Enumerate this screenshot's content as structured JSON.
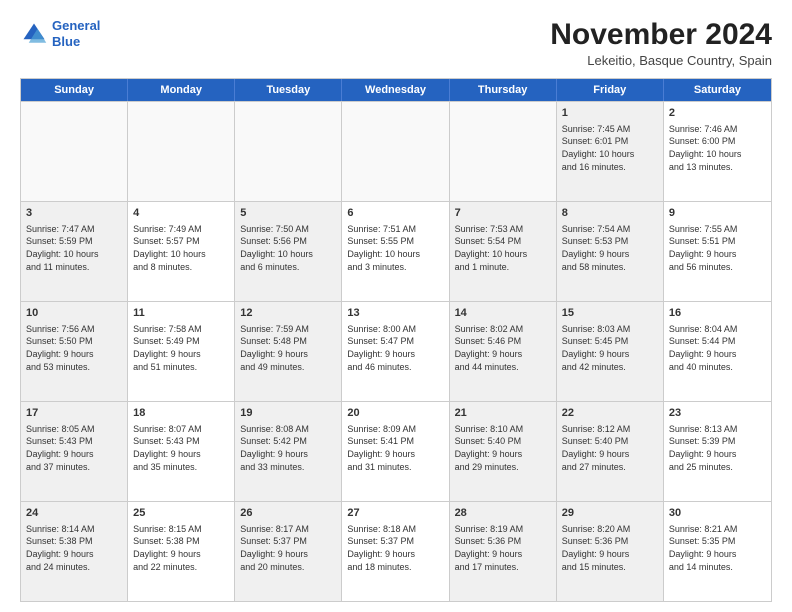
{
  "logo": {
    "line1": "General",
    "line2": "Blue"
  },
  "title": "November 2024",
  "location": "Lekeitio, Basque Country, Spain",
  "dayHeaders": [
    "Sunday",
    "Monday",
    "Tuesday",
    "Wednesday",
    "Thursday",
    "Friday",
    "Saturday"
  ],
  "rows": [
    [
      {
        "day": "",
        "info": "",
        "empty": true
      },
      {
        "day": "",
        "info": "",
        "empty": true
      },
      {
        "day": "",
        "info": "",
        "empty": true
      },
      {
        "day": "",
        "info": "",
        "empty": true
      },
      {
        "day": "",
        "info": "",
        "empty": true
      },
      {
        "day": "1",
        "info": "Sunrise: 7:45 AM\nSunset: 6:01 PM\nDaylight: 10 hours\nand 16 minutes.",
        "shaded": true
      },
      {
        "day": "2",
        "info": "Sunrise: 7:46 AM\nSunset: 6:00 PM\nDaylight: 10 hours\nand 13 minutes."
      }
    ],
    [
      {
        "day": "3",
        "info": "Sunrise: 7:47 AM\nSunset: 5:59 PM\nDaylight: 10 hours\nand 11 minutes.",
        "shaded": true
      },
      {
        "day": "4",
        "info": "Sunrise: 7:49 AM\nSunset: 5:57 PM\nDaylight: 10 hours\nand 8 minutes."
      },
      {
        "day": "5",
        "info": "Sunrise: 7:50 AM\nSunset: 5:56 PM\nDaylight: 10 hours\nand 6 minutes.",
        "shaded": true
      },
      {
        "day": "6",
        "info": "Sunrise: 7:51 AM\nSunset: 5:55 PM\nDaylight: 10 hours\nand 3 minutes."
      },
      {
        "day": "7",
        "info": "Sunrise: 7:53 AM\nSunset: 5:54 PM\nDaylight: 10 hours\nand 1 minute.",
        "shaded": true
      },
      {
        "day": "8",
        "info": "Sunrise: 7:54 AM\nSunset: 5:53 PM\nDaylight: 9 hours\nand 58 minutes.",
        "shaded": true
      },
      {
        "day": "9",
        "info": "Sunrise: 7:55 AM\nSunset: 5:51 PM\nDaylight: 9 hours\nand 56 minutes."
      }
    ],
    [
      {
        "day": "10",
        "info": "Sunrise: 7:56 AM\nSunset: 5:50 PM\nDaylight: 9 hours\nand 53 minutes.",
        "shaded": true
      },
      {
        "day": "11",
        "info": "Sunrise: 7:58 AM\nSunset: 5:49 PM\nDaylight: 9 hours\nand 51 minutes."
      },
      {
        "day": "12",
        "info": "Sunrise: 7:59 AM\nSunset: 5:48 PM\nDaylight: 9 hours\nand 49 minutes.",
        "shaded": true
      },
      {
        "day": "13",
        "info": "Sunrise: 8:00 AM\nSunset: 5:47 PM\nDaylight: 9 hours\nand 46 minutes."
      },
      {
        "day": "14",
        "info": "Sunrise: 8:02 AM\nSunset: 5:46 PM\nDaylight: 9 hours\nand 44 minutes.",
        "shaded": true
      },
      {
        "day": "15",
        "info": "Sunrise: 8:03 AM\nSunset: 5:45 PM\nDaylight: 9 hours\nand 42 minutes.",
        "shaded": true
      },
      {
        "day": "16",
        "info": "Sunrise: 8:04 AM\nSunset: 5:44 PM\nDaylight: 9 hours\nand 40 minutes."
      }
    ],
    [
      {
        "day": "17",
        "info": "Sunrise: 8:05 AM\nSunset: 5:43 PM\nDaylight: 9 hours\nand 37 minutes.",
        "shaded": true
      },
      {
        "day": "18",
        "info": "Sunrise: 8:07 AM\nSunset: 5:43 PM\nDaylight: 9 hours\nand 35 minutes."
      },
      {
        "day": "19",
        "info": "Sunrise: 8:08 AM\nSunset: 5:42 PM\nDaylight: 9 hours\nand 33 minutes.",
        "shaded": true
      },
      {
        "day": "20",
        "info": "Sunrise: 8:09 AM\nSunset: 5:41 PM\nDaylight: 9 hours\nand 31 minutes."
      },
      {
        "day": "21",
        "info": "Sunrise: 8:10 AM\nSunset: 5:40 PM\nDaylight: 9 hours\nand 29 minutes.",
        "shaded": true
      },
      {
        "day": "22",
        "info": "Sunrise: 8:12 AM\nSunset: 5:40 PM\nDaylight: 9 hours\nand 27 minutes.",
        "shaded": true
      },
      {
        "day": "23",
        "info": "Sunrise: 8:13 AM\nSunset: 5:39 PM\nDaylight: 9 hours\nand 25 minutes."
      }
    ],
    [
      {
        "day": "24",
        "info": "Sunrise: 8:14 AM\nSunset: 5:38 PM\nDaylight: 9 hours\nand 24 minutes.",
        "shaded": true
      },
      {
        "day": "25",
        "info": "Sunrise: 8:15 AM\nSunset: 5:38 PM\nDaylight: 9 hours\nand 22 minutes."
      },
      {
        "day": "26",
        "info": "Sunrise: 8:17 AM\nSunset: 5:37 PM\nDaylight: 9 hours\nand 20 minutes.",
        "shaded": true
      },
      {
        "day": "27",
        "info": "Sunrise: 8:18 AM\nSunset: 5:37 PM\nDaylight: 9 hours\nand 18 minutes."
      },
      {
        "day": "28",
        "info": "Sunrise: 8:19 AM\nSunset: 5:36 PM\nDaylight: 9 hours\nand 17 minutes.",
        "shaded": true
      },
      {
        "day": "29",
        "info": "Sunrise: 8:20 AM\nSunset: 5:36 PM\nDaylight: 9 hours\nand 15 minutes.",
        "shaded": true
      },
      {
        "day": "30",
        "info": "Sunrise: 8:21 AM\nSunset: 5:35 PM\nDaylight: 9 hours\nand 14 minutes."
      }
    ]
  ]
}
